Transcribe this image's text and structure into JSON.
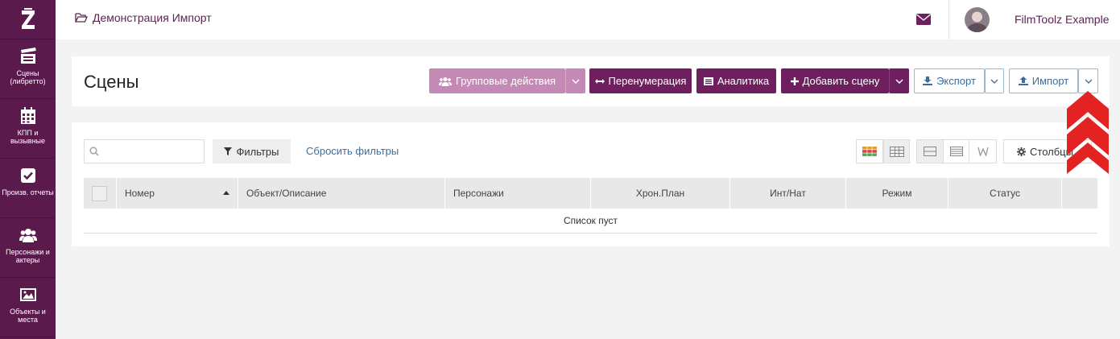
{
  "sidebar": {
    "items": [
      {
        "label": "Сцены (либретто)",
        "icon": "clapperboard-icon"
      },
      {
        "label": "КПП и вызывные",
        "icon": "calendar-icon"
      },
      {
        "label": "Произв. отчеты",
        "icon": "checkbox-icon"
      },
      {
        "label": "Персонажи и актеры",
        "icon": "users-icon"
      },
      {
        "label": "Объекты и места",
        "icon": "image-icon"
      }
    ]
  },
  "topbar": {
    "breadcrumb": "Демонстрация Импорт",
    "username": "FilmToolz Example"
  },
  "header": {
    "title": "Сцены",
    "group_actions": "Групповые действия",
    "renumber": "Перенумерация",
    "analytics": "Аналитика",
    "add_scene": "Добавить сцену",
    "export": "Экспорт",
    "import": "Импорт"
  },
  "list": {
    "search_placeholder": "",
    "filters": "Фильтры",
    "reset_filters": "Сбросить фильтры",
    "columns": "Столбцы",
    "table": {
      "headers": [
        "Номер",
        "Объект/Описание",
        "Персонажи",
        "Хрон.План",
        "Инт/Нат",
        "Режим",
        "Статус"
      ]
    },
    "empty_text": "Список пуст"
  },
  "colors": {
    "sidebar": "#5a1a4b",
    "primary": "#6d1f5e",
    "primary_light": "#c48ab5",
    "link": "#3e6d9a",
    "annotation_arrow": "#e32222"
  }
}
